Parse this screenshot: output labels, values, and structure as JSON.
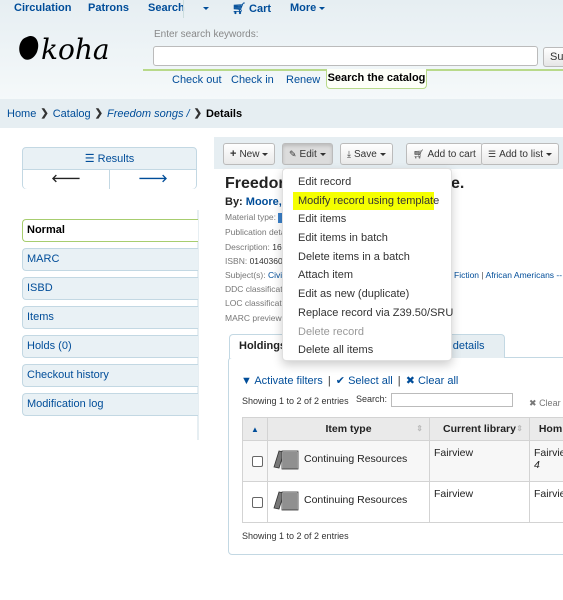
{
  "topnav": {
    "items": [
      "Circulation",
      "Patrons",
      "Search",
      "Cart",
      "More"
    ]
  },
  "logo": {
    "text": "koha"
  },
  "search": {
    "label": "Enter search keywords:",
    "value": "",
    "submit_label": "Submit",
    "submit_visible": "Sul",
    "subtabs": [
      "Check out",
      "Check in",
      "Renew"
    ],
    "active_subtab": "Search the catalog"
  },
  "breadcrumb": {
    "home": "Home",
    "catalog": "Catalog",
    "record": "Freedom songs /",
    "current": "Details"
  },
  "results_box": {
    "label": "Results",
    "prev": "🡐",
    "next": "🡒"
  },
  "sidebar": {
    "items": [
      {
        "label": "Normal",
        "active": true
      },
      {
        "label": "MARC",
        "active": false
      },
      {
        "label": "ISBD",
        "active": false
      },
      {
        "label": "Items",
        "active": false
      },
      {
        "label": "Holds (0)",
        "active": false
      },
      {
        "label": "Checkout history",
        "active": false
      },
      {
        "label": "Modification log",
        "active": false
      }
    ]
  },
  "toolbar": {
    "new": "New",
    "edit": "Edit",
    "save": "Save",
    "add_to_cart": "Add to cart",
    "add_to_list": "Add to list"
  },
  "record": {
    "title_visible_left": "Freedor",
    "title_visible_right": "e.",
    "by_label": "By:",
    "author_visible": "Moore, Y",
    "fields": [
      {
        "label": "Material type:",
        "value": ""
      },
      {
        "label": "Publication deta",
        "value": ""
      },
      {
        "label": "Description:",
        "value": "16"
      },
      {
        "label": "ISBN:",
        "value": "0140360"
      },
      {
        "label": "Subject(s):",
        "value": "Civi"
      },
      {
        "label": "DDC classificat",
        "value": ""
      },
      {
        "label": "LOC classificati",
        "value": ""
      },
      {
        "label": "MARC preview:",
        "value": ""
      }
    ],
    "subject_tail": [
      "Fiction",
      "African Americans --"
    ]
  },
  "edit_menu": {
    "items": [
      {
        "label": "Edit record",
        "state": "normal"
      },
      {
        "label": "Modify record using template",
        "state": "highlight"
      },
      {
        "label": "Edit items",
        "state": "normal"
      },
      {
        "label": "Edit items in batch",
        "state": "normal"
      },
      {
        "label": "Delete items in a batch",
        "state": "normal"
      },
      {
        "label": "Attach item",
        "state": "normal"
      },
      {
        "label": "Edit as new (duplicate)",
        "state": "normal"
      },
      {
        "label": "Replace record via Z39.50/SRU",
        "state": "normal"
      },
      {
        "label": "Delete record",
        "state": "disabled"
      },
      {
        "label": "Delete all items",
        "state": "normal"
      }
    ],
    "highlight_color": "#f5ff00"
  },
  "tabs": {
    "holdings": "Holdings",
    "other_visible": "ion details"
  },
  "holdings": {
    "activate_filters": "Activate filters",
    "select_all": "Select all",
    "clear_all": "Clear all",
    "showing": "Showing 1 to 2 of 2 entries",
    "search_label": "Search:",
    "search_value": "",
    "clear_filter": "Clear",
    "columns": [
      "",
      "Item type",
      "Current library",
      "Hom"
    ],
    "rows": [
      {
        "item_type": "Continuing Resources",
        "current_library": "Fairview",
        "home_library": "Fairvie",
        "extra": "4"
      },
      {
        "item_type": "Continuing Resources",
        "current_library": "Fairview",
        "home_library": "Fairvie",
        "extra": ""
      }
    ]
  },
  "colors": {
    "link": "#004d99",
    "accent_green": "#a7cd6f",
    "header_bg": "#e6eef2"
  }
}
